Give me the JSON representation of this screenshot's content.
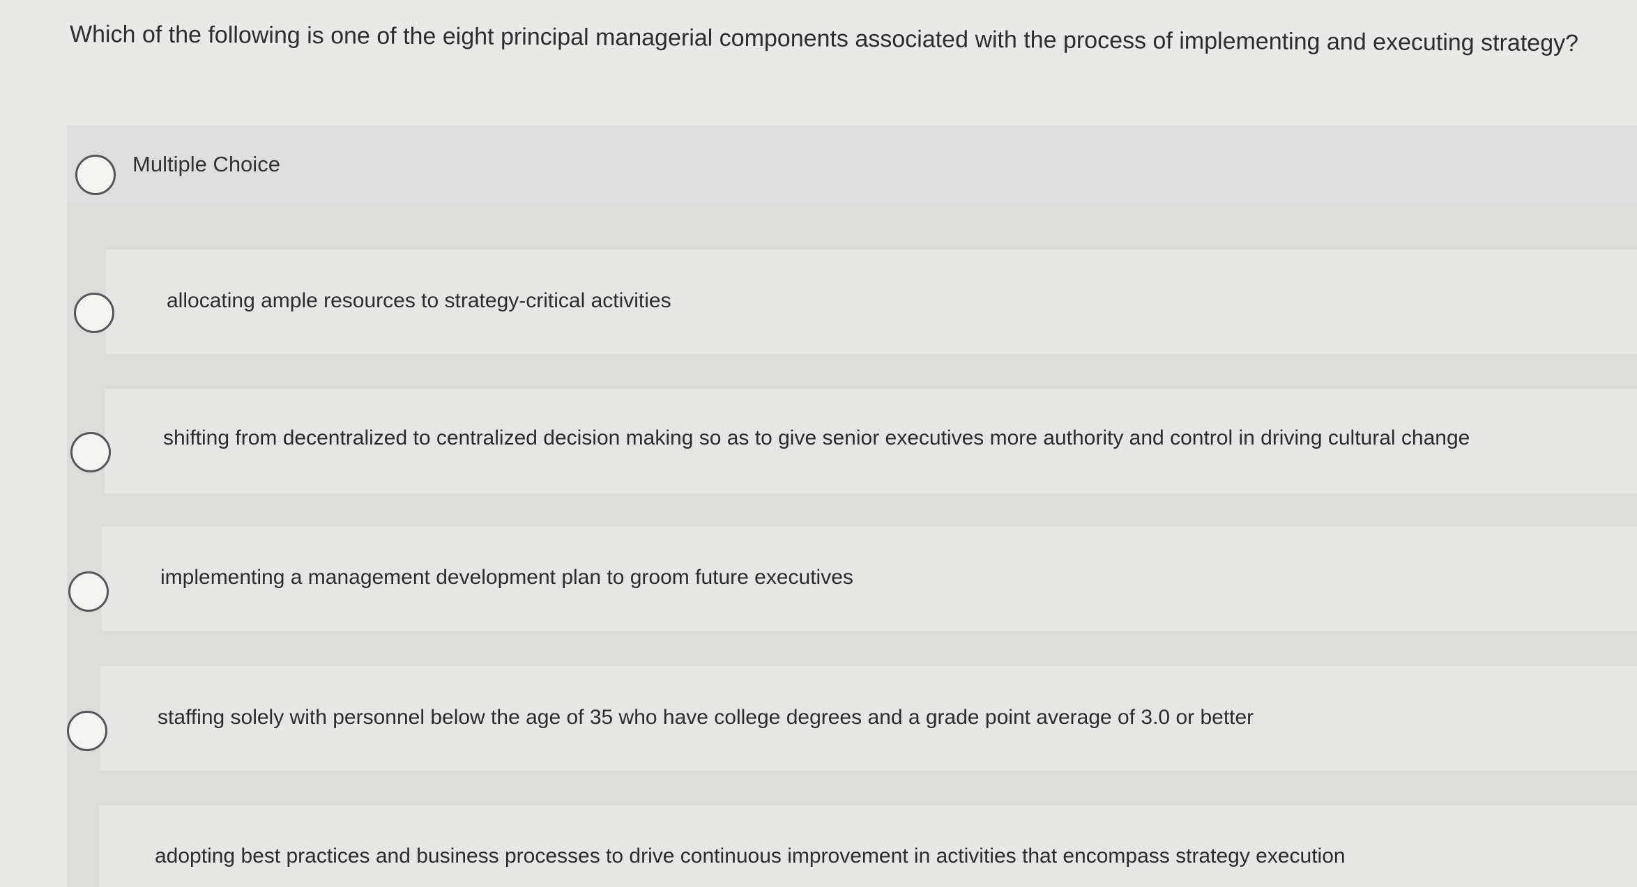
{
  "question": {
    "text": "Which of the following is one of the eight principal managerial components associated with the process of implementing and executing strategy?"
  },
  "multiple_choice": {
    "label": "Multiple Choice",
    "options": [
      {
        "text": "allocating ample resources to strategy-critical activities",
        "selected": false
      },
      {
        "text": "shifting from decentralized to centralized decision making so as to give senior executives more authority and control in driving cultural change",
        "selected": false
      },
      {
        "text": "implementing a management development plan to groom future executives",
        "selected": false
      },
      {
        "text": "staffing solely with personnel below the age of 35 who have college degrees and a grade point average of 3.0 or better",
        "selected": false
      },
      {
        "text": "adopting best practices and business processes to drive continuous improvement in activities that encompass strategy execution",
        "selected": false
      }
    ]
  }
}
